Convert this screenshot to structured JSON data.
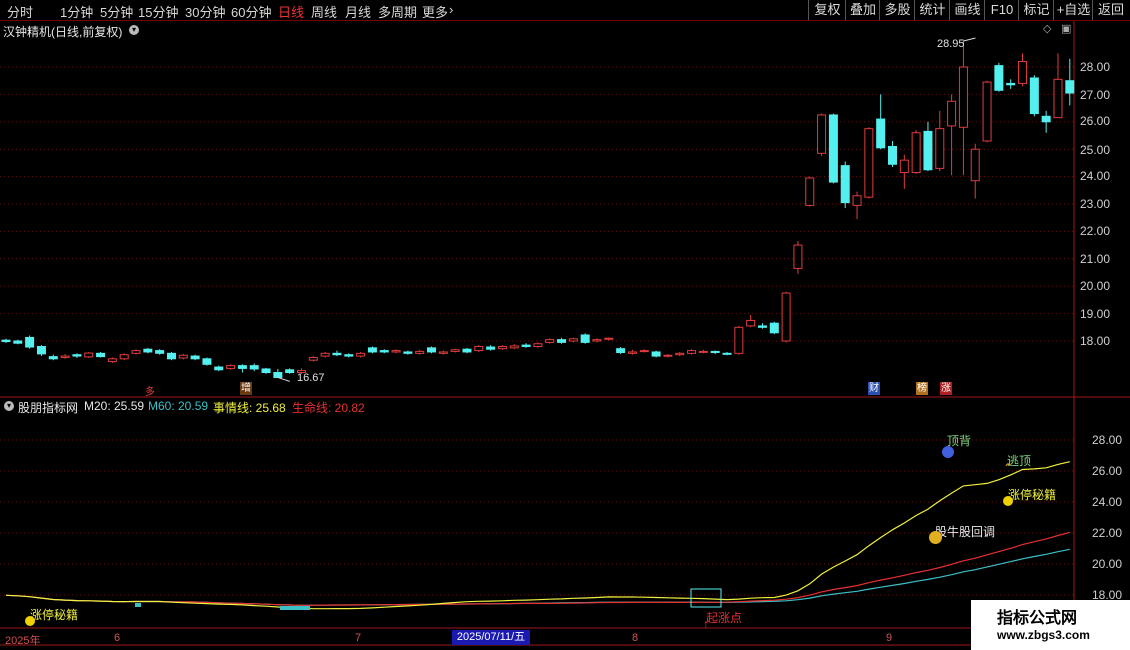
{
  "toolbar": {
    "periods": [
      "分时",
      "1分钟",
      "5分钟",
      "15分钟",
      "30分钟",
      "60分钟",
      "日线",
      "周线",
      "月线",
      "多周期",
      "更多"
    ],
    "active_period": "日线",
    "more_arrow": "›",
    "buttons": [
      "复权",
      "叠加",
      "多股",
      "统计",
      "画线",
      "F10",
      "标记",
      "+自选",
      "返回"
    ]
  },
  "main_panel": {
    "title": "汉钟精机(日线,前复权)",
    "high_label": "28.95",
    "low_label": "16.67",
    "y_ticks": [
      "28.00",
      "27.00",
      "26.00",
      "25.00",
      "24.00",
      "23.00",
      "22.00",
      "21.00",
      "20.00",
      "19.00",
      "18.00"
    ],
    "event_tags": [
      {
        "text": "多",
        "color": "#e04040"
      },
      {
        "text": "增",
        "color": "#ffffff"
      }
    ],
    "event_badges": [
      {
        "text": "财",
        "color": "#2a4fb0"
      },
      {
        "text": "榜",
        "color": "#b07020"
      },
      {
        "text": "涨",
        "color": "#b02020"
      }
    ]
  },
  "indicator_panel": {
    "title": "股朋指标网",
    "m20_label": "M20: 25.59",
    "m60_label": "M60: 20.59",
    "shiqing_label": "事情线: 25.68",
    "shengming_label": "生命线: 20.82",
    "y_ticks": [
      "28.00",
      "26.00",
      "24.00",
      "22.00",
      "20.00",
      "18.00"
    ],
    "signals": {
      "dingbei": "顶背",
      "taoding": "逃顶",
      "zhangting_right": "涨停秘籍",
      "niugu": "股牛股回调",
      "zhangting_left": "涨停秘籍",
      "qizhangdian": "起涨点"
    }
  },
  "x_axis": {
    "labels": [
      "2025年",
      "6",
      "7",
      "8",
      "9"
    ],
    "cursor_date": "2025/07/11/五"
  },
  "colors": {
    "up": "#e03c3c",
    "down": "#54f0f0",
    "grid": "#6a1010",
    "m20": "#e8e8e8",
    "m60": "#3cc0c8",
    "shiqing": "#f0f040",
    "shengming": "#e83030"
  },
  "chart_data": {
    "type": "candlestick",
    "ylim": [
      17.0,
      29.0
    ],
    "high": 28.95,
    "low": 16.67,
    "candles": [
      [
        18.03,
        17.98,
        18.08,
        17.93
      ],
      [
        18.0,
        17.92,
        18.05,
        17.88
      ],
      [
        18.13,
        17.78,
        18.2,
        17.72
      ],
      [
        17.8,
        17.53,
        17.85,
        17.45
      ],
      [
        17.43,
        17.35,
        17.5,
        17.3
      ],
      [
        17.4,
        17.45,
        17.52,
        17.35
      ],
      [
        17.5,
        17.45,
        17.55,
        17.38
      ],
      [
        17.42,
        17.56,
        17.6,
        17.38
      ],
      [
        17.55,
        17.43,
        17.6,
        17.4
      ],
      [
        17.25,
        17.35,
        17.4,
        17.2
      ],
      [
        17.35,
        17.5,
        17.55,
        17.3
      ],
      [
        17.55,
        17.65,
        17.7,
        17.5
      ],
      [
        17.7,
        17.6,
        17.75,
        17.55
      ],
      [
        17.65,
        17.55,
        17.7,
        17.5
      ],
      [
        17.55,
        17.35,
        17.6,
        17.3
      ],
      [
        17.38,
        17.48,
        17.53,
        17.33
      ],
      [
        17.45,
        17.35,
        17.5,
        17.3
      ],
      [
        17.35,
        17.15,
        17.4,
        17.1
      ],
      [
        17.05,
        16.95,
        17.1,
        16.9
      ],
      [
        17.0,
        17.1,
        17.15,
        16.95
      ],
      [
        17.1,
        17.0,
        17.15,
        16.85
      ],
      [
        17.1,
        16.98,
        17.18,
        16.9
      ],
      [
        16.98,
        16.85,
        17.02,
        16.8
      ],
      [
        16.85,
        16.67,
        16.98,
        16.67
      ],
      [
        16.95,
        16.85,
        17.0,
        16.8
      ],
      [
        16.85,
        16.92,
        17.0,
        16.8
      ],
      [
        17.3,
        17.4,
        17.45,
        17.25
      ],
      [
        17.45,
        17.55,
        17.6,
        17.4
      ],
      [
        17.55,
        17.5,
        17.65,
        17.45
      ],
      [
        17.5,
        17.45,
        17.55,
        17.4
      ],
      [
        17.45,
        17.55,
        17.6,
        17.4
      ],
      [
        17.75,
        17.6,
        17.8,
        17.55
      ],
      [
        17.65,
        17.6,
        17.7,
        17.55
      ],
      [
        17.6,
        17.65,
        17.7,
        17.55
      ],
      [
        17.6,
        17.55,
        17.65,
        17.5
      ],
      [
        17.55,
        17.62,
        17.68,
        17.5
      ],
      [
        17.75,
        17.6,
        17.8,
        17.55
      ],
      [
        17.55,
        17.6,
        17.65,
        17.5
      ],
      [
        17.62,
        17.68,
        17.72,
        17.58
      ],
      [
        17.7,
        17.6,
        17.75,
        17.55
      ],
      [
        17.65,
        17.8,
        17.85,
        17.6
      ],
      [
        17.78,
        17.7,
        17.85,
        17.65
      ],
      [
        17.72,
        17.8,
        17.85,
        17.68
      ],
      [
        17.75,
        17.82,
        17.88,
        17.7
      ],
      [
        17.85,
        17.8,
        17.92,
        17.75
      ],
      [
        17.8,
        17.9,
        17.95,
        17.75
      ],
      [
        17.95,
        18.05,
        18.1,
        17.9
      ],
      [
        18.05,
        17.95,
        18.12,
        17.9
      ],
      [
        18.0,
        18.08,
        18.12,
        17.95
      ],
      [
        18.22,
        17.95,
        18.28,
        17.9
      ],
      [
        18.0,
        18.05,
        18.1,
        17.95
      ],
      [
        18.08,
        18.1,
        18.13,
        18.02
      ],
      [
        17.72,
        17.58,
        17.78,
        17.52
      ],
      [
        17.55,
        17.6,
        17.68,
        17.5
      ],
      [
        17.62,
        17.65,
        17.7,
        17.58
      ],
      [
        17.6,
        17.45,
        17.65,
        17.4
      ],
      [
        17.45,
        17.48,
        17.52,
        17.4
      ],
      [
        17.5,
        17.55,
        17.6,
        17.45
      ],
      [
        17.55,
        17.65,
        17.7,
        17.5
      ],
      [
        17.6,
        17.62,
        17.68,
        17.55
      ],
      [
        17.62,
        17.58,
        17.65,
        17.52
      ],
      [
        17.55,
        17.52,
        17.6,
        17.48
      ],
      [
        17.55,
        18.5,
        18.55,
        17.5
      ],
      [
        18.55,
        18.75,
        18.95,
        18.5
      ],
      [
        18.55,
        18.5,
        18.65,
        18.45
      ],
      [
        18.65,
        18.3,
        18.7,
        18.25
      ],
      [
        18.0,
        19.75,
        19.8,
        17.95
      ],
      [
        20.65,
        21.5,
        21.65,
        20.45
      ],
      [
        22.95,
        23.95,
        24.0,
        22.9
      ],
      [
        24.85,
        26.25,
        26.3,
        24.75
      ],
      [
        26.25,
        23.8,
        26.3,
        23.75
      ],
      [
        24.4,
        23.05,
        24.55,
        22.85
      ],
      [
        22.95,
        23.3,
        23.45,
        22.45
      ],
      [
        23.25,
        25.75,
        25.8,
        23.2
      ],
      [
        26.1,
        25.05,
        27.0,
        25.0
      ],
      [
        25.1,
        24.45,
        25.3,
        24.35
      ],
      [
        24.15,
        24.6,
        24.8,
        23.55
      ],
      [
        24.15,
        25.6,
        25.7,
        24.1
      ],
      [
        25.65,
        24.25,
        26.0,
        24.2
      ],
      [
        24.3,
        25.75,
        26.4,
        24.2
      ],
      [
        25.85,
        26.75,
        27.0,
        24.05
      ],
      [
        25.8,
        28.0,
        28.95,
        24.05
      ],
      [
        23.85,
        25.0,
        25.2,
        23.2
      ],
      [
        25.3,
        27.45,
        27.5,
        25.25
      ],
      [
        28.05,
        27.15,
        28.15,
        27.1
      ],
      [
        27.4,
        27.35,
        27.55,
        27.2
      ],
      [
        27.4,
        28.2,
        28.5,
        27.3
      ],
      [
        27.6,
        26.3,
        27.7,
        26.2
      ],
      [
        26.2,
        26.0,
        26.4,
        25.6
      ],
      [
        26.15,
        27.55,
        28.5,
        26.15
      ],
      [
        27.5,
        27.05,
        28.3,
        26.6
      ]
    ],
    "indicator": {
      "ylim": [
        17.4,
        29.8
      ],
      "series": [
        {
          "name": "M20",
          "last": 25.59
        },
        {
          "name": "M60",
          "last": 20.59
        },
        {
          "name": "事情线",
          "last": 25.68
        },
        {
          "name": "生命线",
          "last": 20.82
        }
      ]
    }
  }
}
